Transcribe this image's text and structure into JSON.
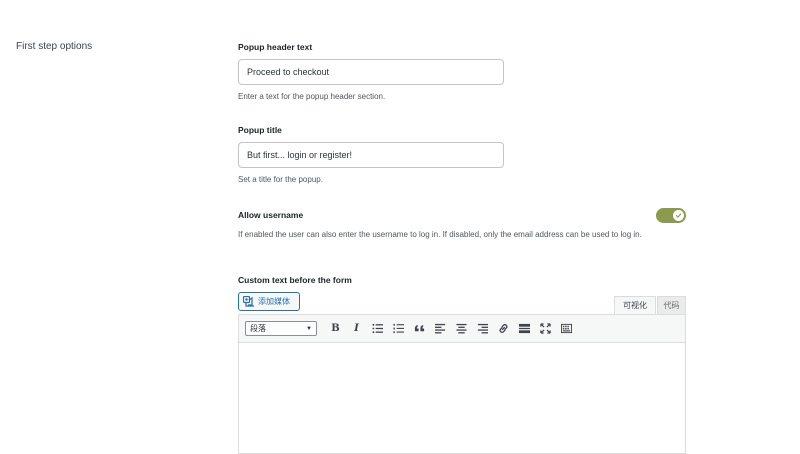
{
  "section": {
    "title": "First step options"
  },
  "fields": {
    "popup_header": {
      "label": "Popup header text",
      "value": "Proceed to checkout",
      "description": "Enter a text for the popup header section."
    },
    "popup_title": {
      "label": "Popup title",
      "value": "But first... login or register!",
      "description": "Set a title for the popup."
    },
    "allow_username": {
      "label": "Allow username",
      "enabled": true,
      "description": "If enabled the user can also enter the username to log in. If disabled, only the email address can be used to log in."
    },
    "custom_text": {
      "label": "Custom text before the form"
    }
  },
  "editor": {
    "add_media_label": "添加媒体",
    "tabs": {
      "visual": "可视化",
      "code": "代码"
    },
    "format_select": "段落",
    "toolbar_icons": [
      "bold-icon",
      "italic-icon",
      "bullet-list-icon",
      "numbered-list-icon",
      "blockquote-icon",
      "align-left-icon",
      "align-center-icon",
      "align-right-icon",
      "link-icon",
      "read-more-icon",
      "fullscreen-icon",
      "toolbar-toggle-icon"
    ]
  },
  "colors": {
    "toggle_on": "#8b9a4c",
    "primary": "#2271b1"
  }
}
